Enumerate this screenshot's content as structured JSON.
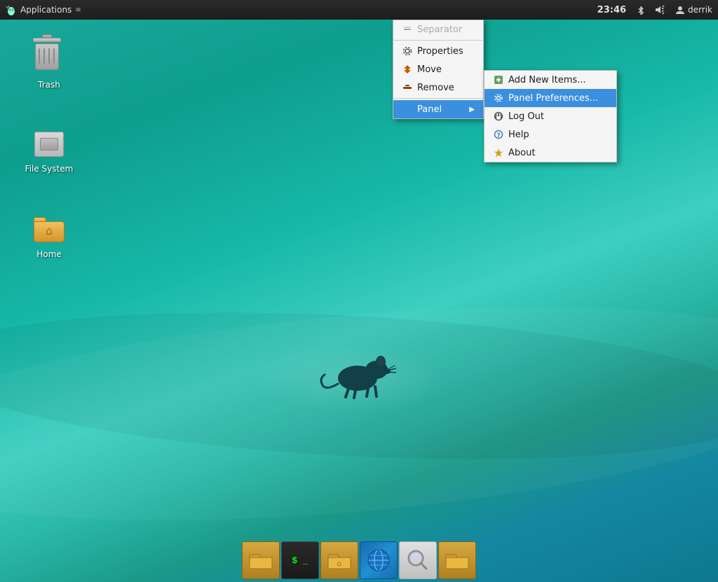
{
  "desktop": {
    "background_colors": [
      "#1aa89a",
      "#0e9e8e",
      "#3ecfc0",
      "#1488a0"
    ]
  },
  "top_panel": {
    "applications_label": "Applications",
    "clock": "23:46",
    "bluetooth_icon": "bluetooth-icon",
    "volume_icon": "volume-icon",
    "user_label": "derrik"
  },
  "desktop_icons": [
    {
      "id": "trash",
      "label": "Trash",
      "type": "trash"
    },
    {
      "id": "filesystem",
      "label": "File System",
      "type": "hdd"
    },
    {
      "id": "home",
      "label": "Home",
      "type": "folder"
    }
  ],
  "context_menu": {
    "items": [
      {
        "id": "separator-item",
        "label": "Separator",
        "icon": "separator-icon",
        "disabled": true,
        "type": "separator-header"
      },
      {
        "id": "properties",
        "label": "Properties",
        "icon": "gear-icon",
        "disabled": false
      },
      {
        "id": "move",
        "label": "Move",
        "icon": "move-icon",
        "disabled": false
      },
      {
        "id": "remove",
        "label": "Remove",
        "icon": "remove-icon",
        "disabled": false
      },
      {
        "id": "panel",
        "label": "Panel",
        "icon": null,
        "disabled": false,
        "has_submenu": true,
        "active": true
      }
    ]
  },
  "submenu": {
    "items": [
      {
        "id": "add-new-items",
        "label": "Add New Items...",
        "icon": "add-icon"
      },
      {
        "id": "panel-preferences",
        "label": "Panel Preferences...",
        "icon": "gear-icon",
        "active": true
      },
      {
        "id": "log-out",
        "label": "Log Out",
        "icon": "logout-icon"
      },
      {
        "id": "help",
        "label": "Help",
        "icon": "help-icon"
      },
      {
        "id": "about",
        "label": "About",
        "icon": "star-icon"
      }
    ]
  },
  "taskbar": {
    "items": [
      {
        "id": "files",
        "label": "Files",
        "type": "folder"
      },
      {
        "id": "terminal",
        "label": "Terminal",
        "type": "terminal",
        "text": "$ _"
      },
      {
        "id": "home-folder",
        "label": "Home",
        "type": "folder-home"
      },
      {
        "id": "browser",
        "label": "Browser",
        "type": "globe"
      },
      {
        "id": "search",
        "label": "Search",
        "type": "search"
      },
      {
        "id": "files2",
        "label": "Files2",
        "type": "folder"
      }
    ]
  }
}
